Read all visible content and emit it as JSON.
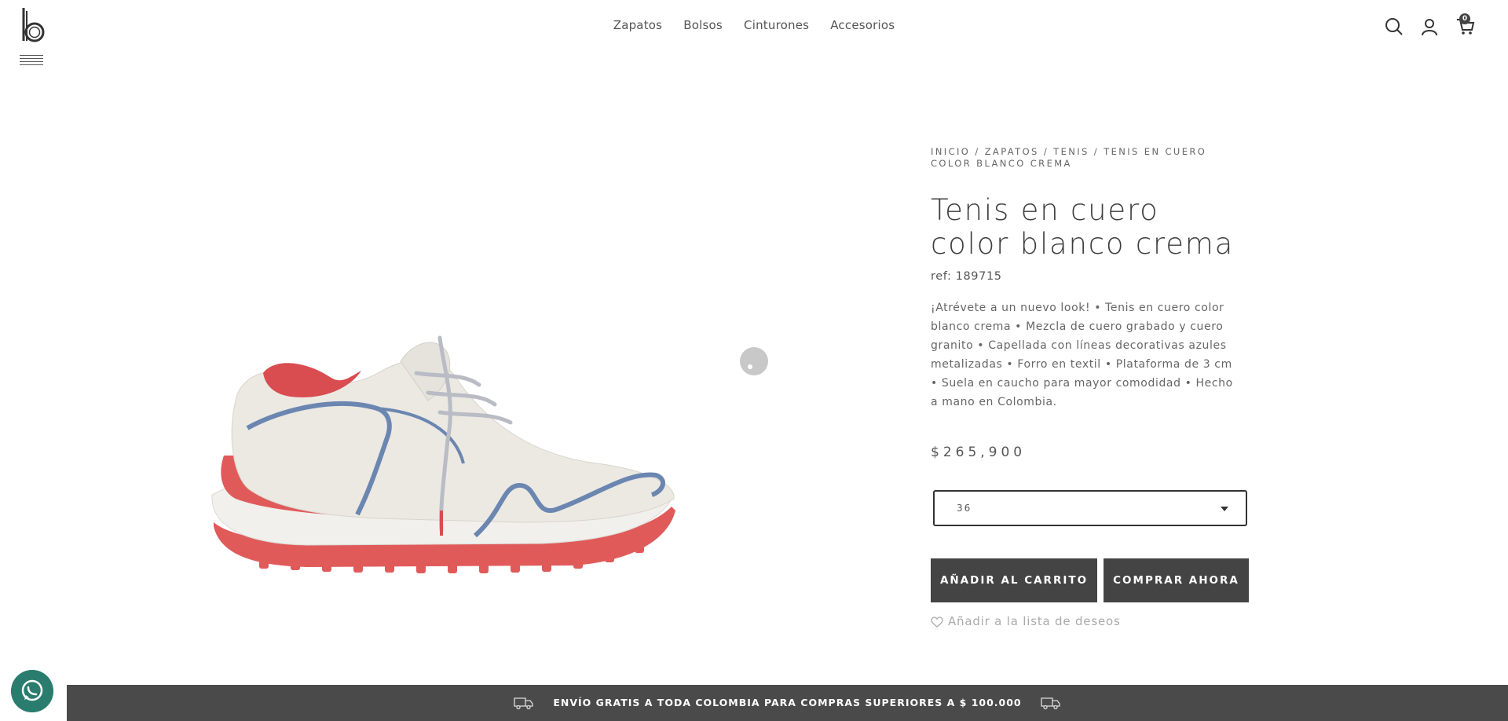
{
  "header": {
    "logo_icon": "brand-b-logo",
    "menu_icon": "hamburger-icon",
    "nav": [
      {
        "label": "Zapatos"
      },
      {
        "label": "Bolsos"
      },
      {
        "label": "Cinturones"
      },
      {
        "label": "Accesorios"
      }
    ],
    "icons": [
      "search-icon",
      "user-icon",
      "cart-icon"
    ],
    "cart_count": "0"
  },
  "breadcrumb": {
    "items": [
      "INICIO",
      "ZAPATOS",
      "TENIS",
      "TENIS EN CUERO COLOR BLANCO CREMA"
    ],
    "separator": " / "
  },
  "product": {
    "title": "Tenis en cuero color blanco crema",
    "ref": "ref: 189715",
    "description": "¡Atrévete a un nuevo look! • Tenis en cuero color blanco crema • Mezcla de cuero grabado y cuero granito • Capellada con líneas decorativas azules metalizadas • Forro en textil • Plataforma de 3 cm • Suela en caucho para mayor comodidad • Hecho a mano en Colombia.",
    "price": "$265,900",
    "size_selected": "36",
    "add_to_cart_label": "AÑADIR AL CARRITO",
    "buy_now_label": "COMPRAR AHORA",
    "wishlist_label": "Añadir a la lista de deseos"
  },
  "footer": {
    "shipping_text": "ENVÍO GRATIS A TODA COLOMBIA PARA COMPRAS SUPERIORES A $ 100.000",
    "truck_icon": "truck-icon",
    "whatsapp_icon": "whatsapp-icon"
  },
  "colors": {
    "dark_button": "#444444",
    "shoe_red": "#e15a5a",
    "shoe_blue": "#6b86b0",
    "whatsapp_green": "#2a7d6e"
  }
}
